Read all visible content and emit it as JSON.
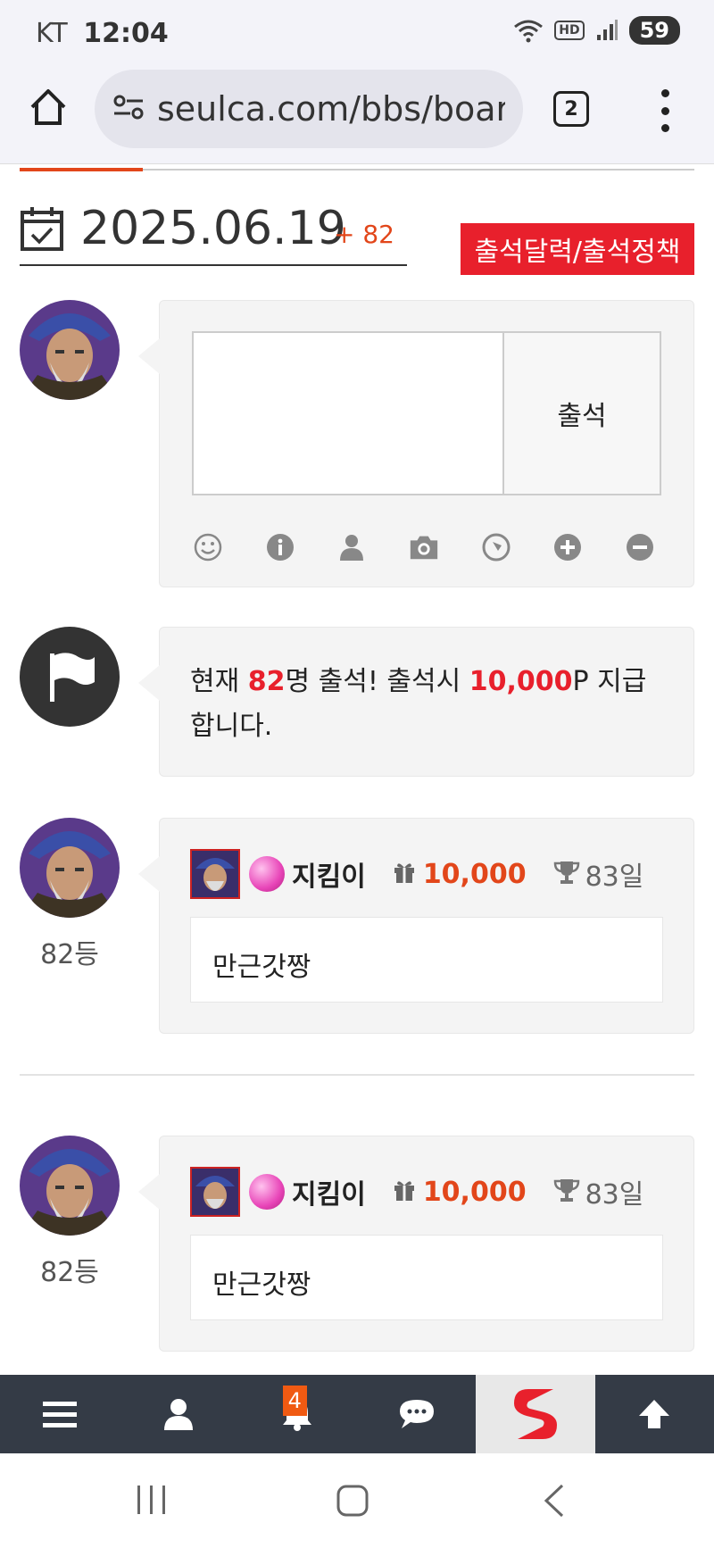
{
  "status_bar": {
    "carrier": "KT",
    "time": "12:04",
    "network": "HD",
    "battery": "59"
  },
  "browser": {
    "url": "seulca.com/bbs/board",
    "tab_count": "2"
  },
  "header": {
    "date": "2025.06.19",
    "attendance_count": "+ 82",
    "policy_button": "출석달력/출석정책"
  },
  "compose": {
    "button_label": "출석"
  },
  "notice": {
    "prefix": "현재 ",
    "count": "82",
    "middle": "명 출석! 출석시 ",
    "points": "10,000",
    "suffix": "P 지급합니다."
  },
  "entries": [
    {
      "rank": "82등",
      "nickname": "지킴이",
      "points": "10,000",
      "days": "83일",
      "comment": "만근갓짱"
    },
    {
      "rank": "82등",
      "nickname": "지킴이",
      "points": "10,000",
      "days": "83일",
      "comment": "만근갓짱"
    }
  ],
  "bottom_nav": {
    "notification_badge": "4"
  },
  "colors": {
    "accent": "#e2461a",
    "policy_red": "#e8202c",
    "nav_bg": "#343b46"
  }
}
